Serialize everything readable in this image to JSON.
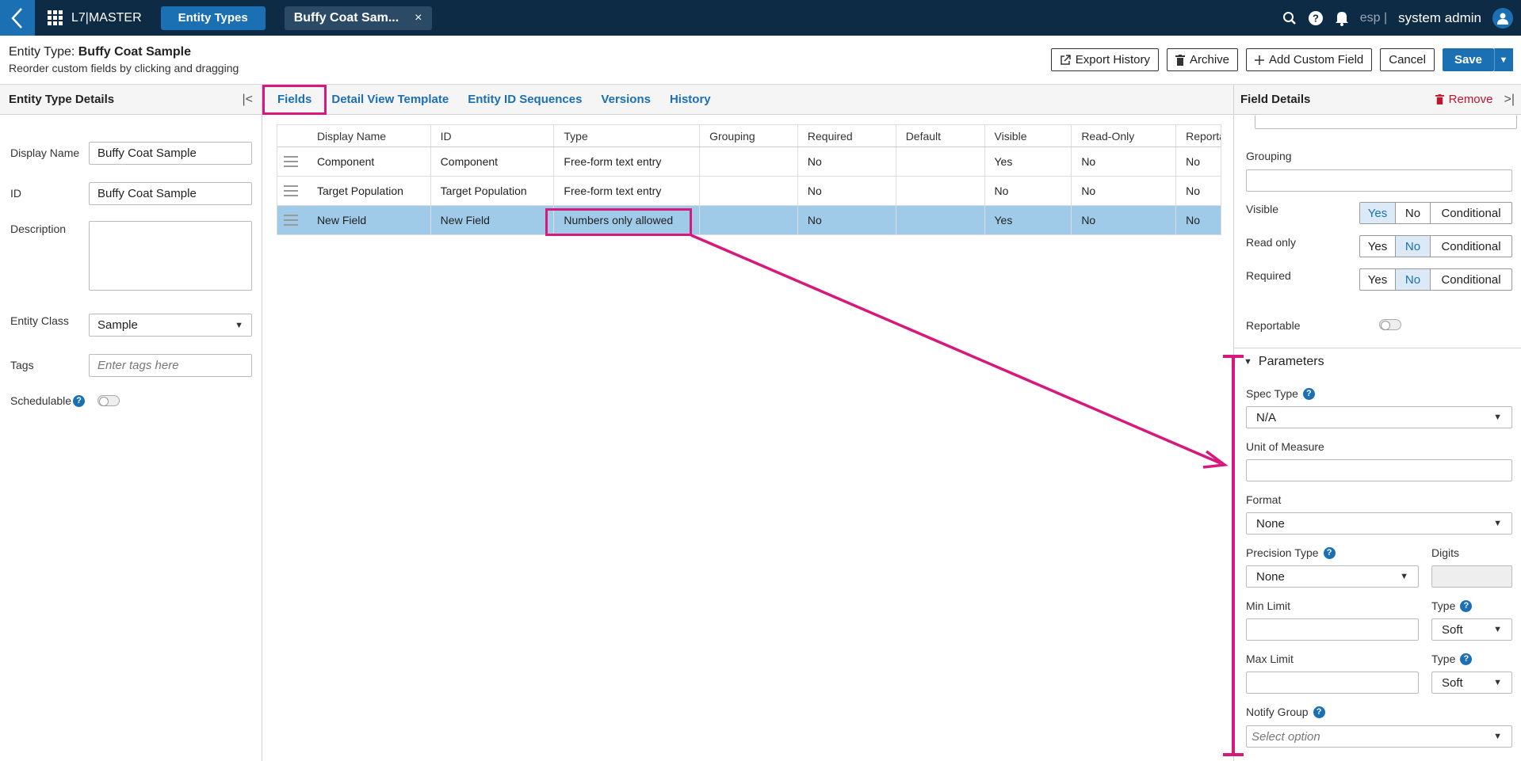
{
  "topbar": {
    "brand": "L7|MASTER",
    "tab_entity_types": "Entity Types",
    "tab_doc": "Buffy Coat Sam...",
    "tab_close": "×",
    "lang": "esp |",
    "user": "system admin"
  },
  "header": {
    "title_prefix": "Entity Type: ",
    "title_value": "Buffy Coat Sample",
    "subtitle": "Reorder custom fields by clicking and dragging",
    "export_history": "Export History",
    "archive": "Archive",
    "add_custom_field": "Add Custom Field",
    "cancel": "Cancel",
    "save": "Save"
  },
  "left_panel": {
    "title": "Entity Type Details",
    "display_name_label": "Display Name",
    "display_name_value": "Buffy Coat Sample",
    "id_label": "ID",
    "id_value": "Buffy Coat Sample",
    "description_label": "Description",
    "entity_class_label": "Entity Class",
    "entity_class_value": "Sample",
    "tags_label": "Tags",
    "tags_placeholder": "Enter tags here",
    "schedulable_label": "Schedulable"
  },
  "tabs": [
    "Fields",
    "Detail View Template",
    "Entity ID Sequences",
    "Versions",
    "History"
  ],
  "grid": {
    "columns": [
      "Display Name",
      "ID",
      "Type",
      "Grouping",
      "Required",
      "Default",
      "Visible",
      "Read-Only",
      "Reportat"
    ],
    "rows": [
      [
        "Component",
        "Component",
        "Free-form text entry",
        "",
        "No",
        "",
        "Yes",
        "No",
        "No"
      ],
      [
        "Target Population",
        "Target Population",
        "Free-form text entry",
        "",
        "No",
        "",
        "No",
        "No",
        "No"
      ],
      [
        "New Field",
        "New Field",
        "Numbers only allowed",
        "",
        "No",
        "",
        "Yes",
        "No",
        "No"
      ]
    ]
  },
  "right_panel": {
    "title": "Field Details",
    "remove": "Remove",
    "grouping_label": "Grouping",
    "visible_label": "Visible",
    "read_only_label": "Read only",
    "required_label": "Required",
    "reportable_label": "Reportable",
    "seg_yes": "Yes",
    "seg_no": "No",
    "seg_conditional": "Conditional",
    "parameters_label": "Parameters",
    "spec_type_label": "Spec Type",
    "spec_type_value": "N/A",
    "unit_label": "Unit of Measure",
    "format_label": "Format",
    "format_value": "None",
    "precision_type_label": "Precision Type",
    "precision_type_value": "None",
    "digits_label": "Digits",
    "min_limit_label": "Min Limit",
    "max_limit_label": "Max Limit",
    "type_label": "Type",
    "soft_value": "Soft",
    "notify_group_label": "Notify Group",
    "notify_group_placeholder": "Select option"
  },
  "colors": {
    "nav_bg": "#0e2b45",
    "accent": "#1b6fb3",
    "highlight": "#d6197b",
    "selected_row": "#9fcbe9",
    "remove": "#c0142e"
  }
}
